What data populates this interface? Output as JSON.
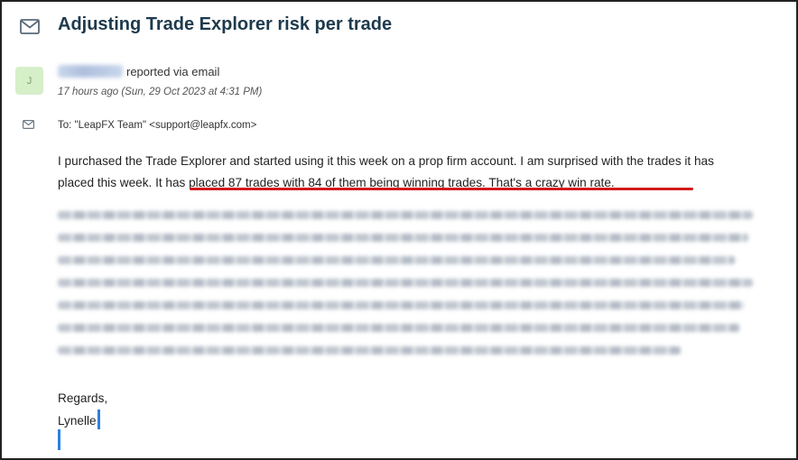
{
  "ticket": {
    "title": "Adjusting Trade Explorer risk per trade",
    "avatar_initial": "J",
    "reported_via": "reported via email",
    "timestamp": "17 hours ago (Sun, 29 Oct 2023 at 4:31 PM)",
    "to_line": "To: \"LeapFX Team\" <support@leapfx.com>"
  },
  "message": {
    "paragraph_1_part_1": "I purchased the Trade Explorer and started using it this week on a prop firm account.  I am surprised with the trades it has placed this week.  ",
    "paragraph_1_highlight": "It has placed 87 trades with 84 of them being winning trades.  That's a crazy win rate.",
    "regards": "Regards,",
    "signature": "Lynelle"
  },
  "icons": {
    "title_icon": "mail-icon",
    "to_icon": "mail-icon"
  },
  "colors": {
    "title": "#1e3a4d",
    "avatar_bg": "#d6efc9",
    "annotation_underline": "#d21a1a",
    "caret": "#2f7fe0"
  }
}
